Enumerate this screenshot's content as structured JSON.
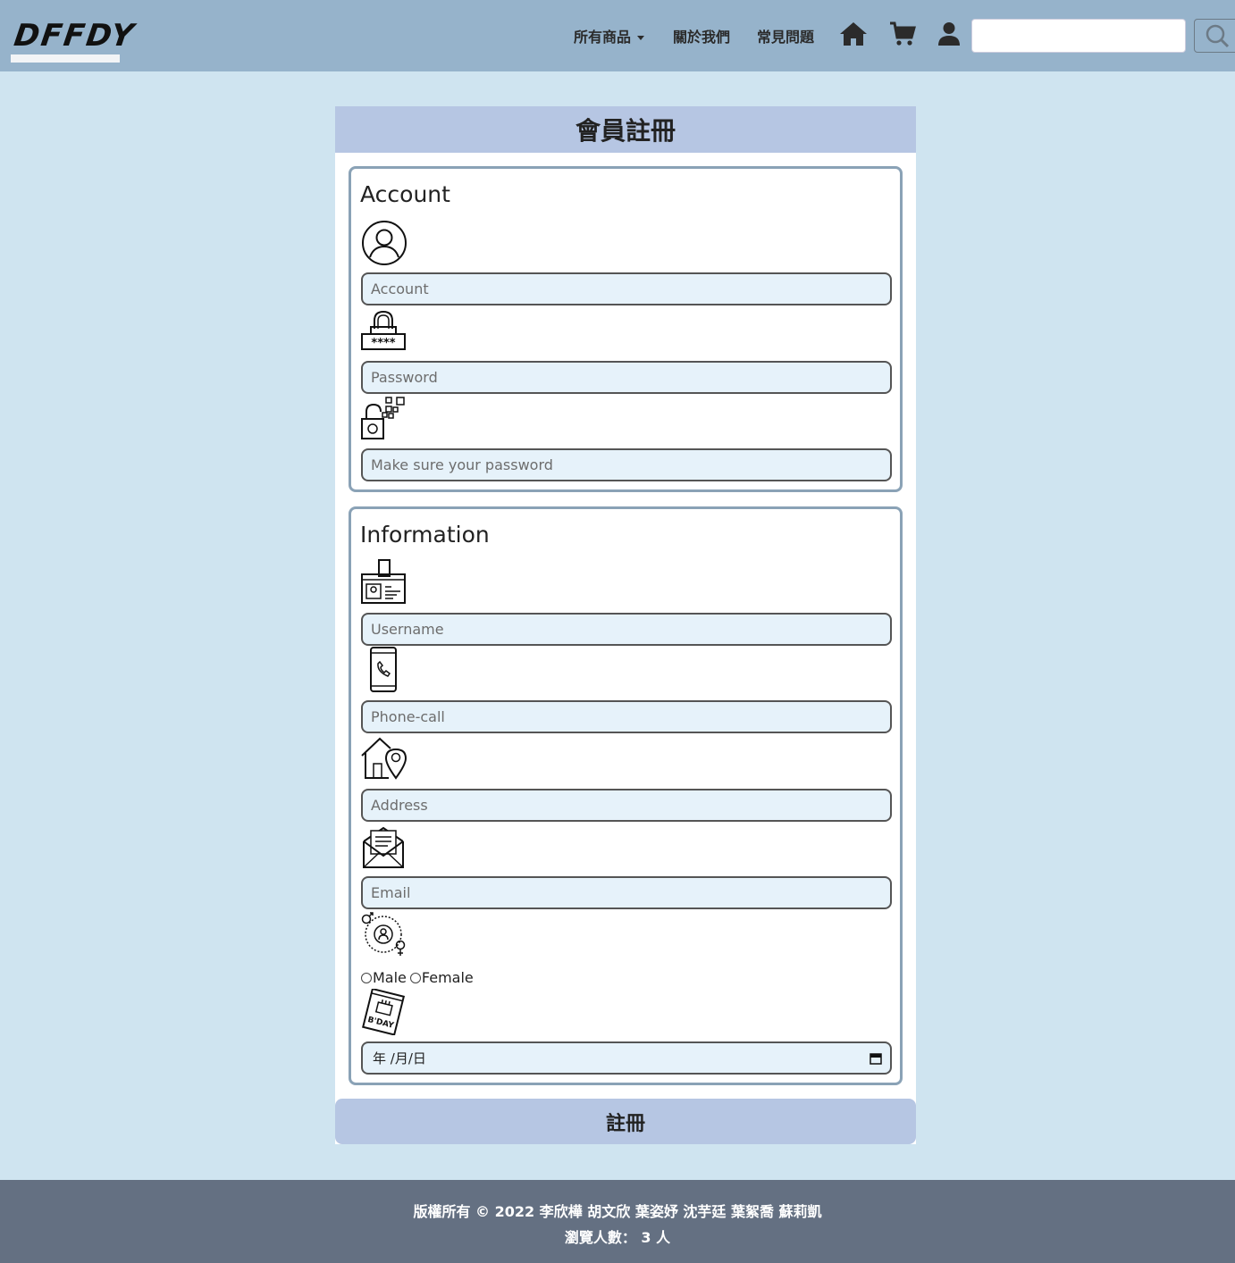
{
  "nav": {
    "logo": "DFFDY",
    "products": "所有商品",
    "about": "關於我們",
    "faq": "常見問題",
    "search_placeholder": ""
  },
  "card": {
    "title": "會員註冊",
    "account_section": {
      "legend": "Account",
      "account_placeholder": "Account",
      "password_placeholder": "Password",
      "confirm_placeholder": "Make sure your password"
    },
    "info_section": {
      "legend": "Information",
      "username_placeholder": "Username",
      "phone_placeholder": "Phone-call",
      "address_placeholder": "Address",
      "email_placeholder": "Email",
      "gender_male": "Male",
      "gender_female": "Female",
      "date_value": "年 /月/日",
      "bday_icon_text": "B'DAY"
    },
    "submit": "註冊"
  },
  "footer": {
    "copyright": "版權所有 © 2022 李欣樺 胡文欣 葉姿妤 沈芋廷 葉絮喬 蘇莉凱",
    "visitors": "瀏覽人數： 3 人"
  },
  "colors": {
    "navbar": "#96b3cb",
    "page_bg": "#cfe4f0",
    "header": "#b6c6e3",
    "footer": "#647082",
    "field_bg": "#e6f2fa"
  }
}
